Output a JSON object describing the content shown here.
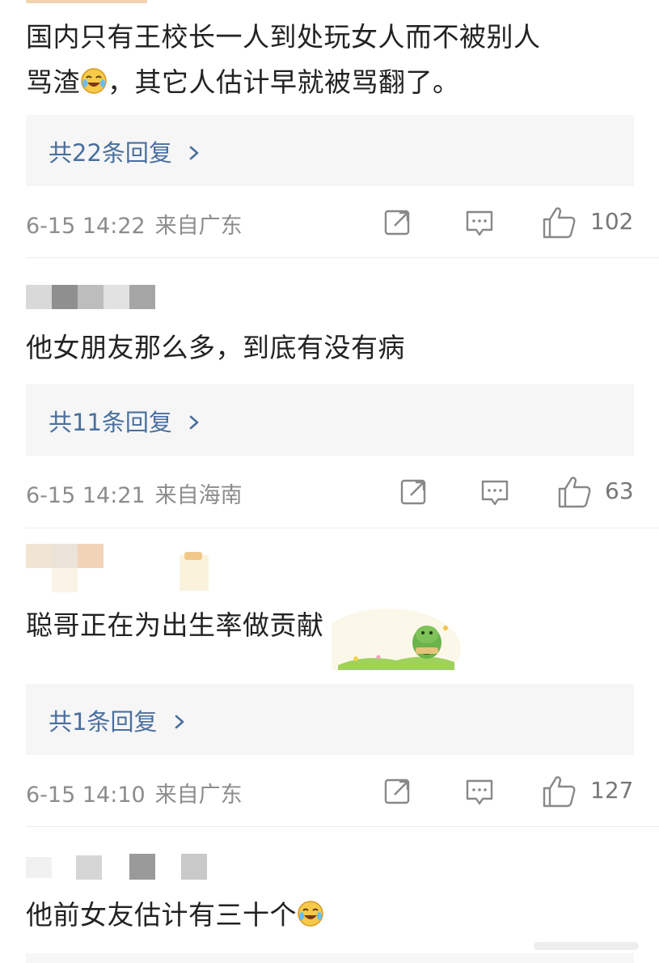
{
  "comments": [
    {
      "text_a": "国内只有王校长一人到处玩女人而不被别人",
      "text_b1": "骂渣",
      "text_b2": "，其它人估计早就被骂翻了。",
      "reply_label": "共22条回复",
      "time": "6-15 14:22",
      "location": "来自广东",
      "likes": "102"
    },
    {
      "text": "他女朋友那么多，到底有没有病",
      "reply_label": "共11条回复",
      "time": "6-15 14:21",
      "location": "来自海南",
      "likes": "63"
    },
    {
      "text": "聪哥正在为出生率做贡献",
      "reply_label": "共1条回复",
      "time": "6-15 14:10",
      "location": "来自广东",
      "likes": "127"
    },
    {
      "text": "他前女友估计有三十个"
    }
  ],
  "icons": {
    "share": "share-icon",
    "comment": "comment-icon",
    "like": "thumb-up-icon",
    "laugh_cry": "laugh-cry-emoji-icon",
    "reply_chevron": "chevron-right-icon"
  },
  "colors": {
    "reply_link": "#4a6f9d",
    "meta": "#8c8c8c",
    "reply_bg": "#f6f6f7"
  }
}
